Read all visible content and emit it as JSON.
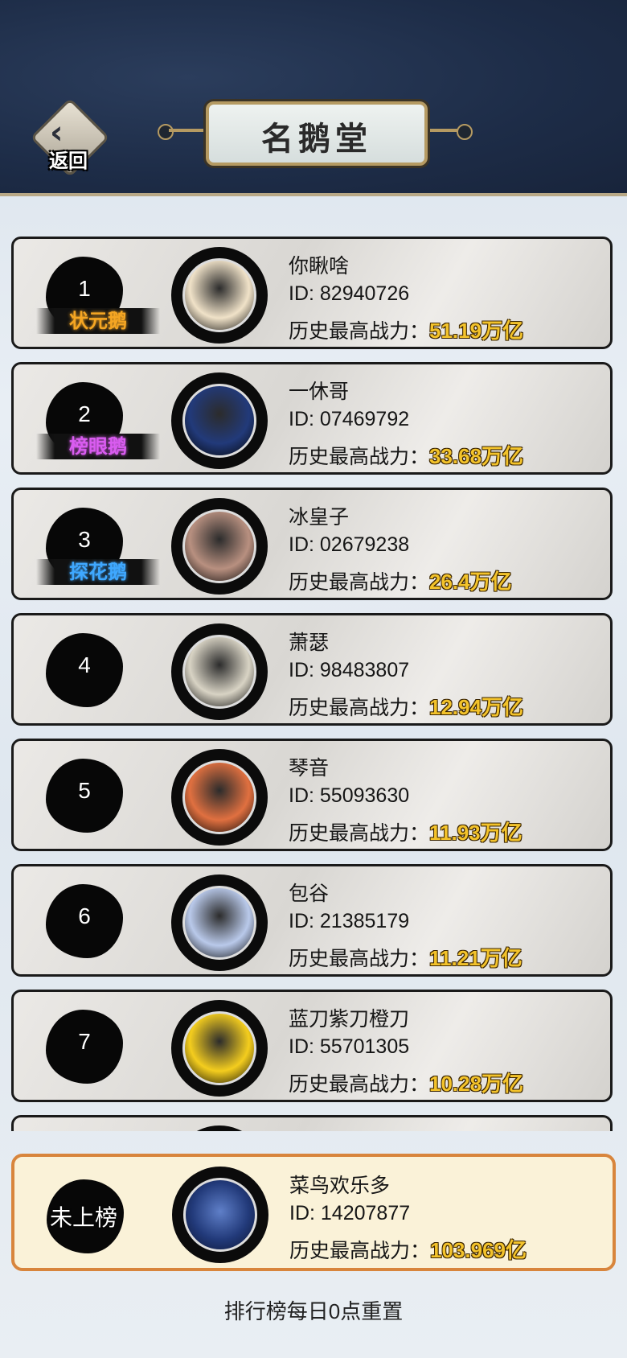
{
  "header": {
    "title": "名鹅堂",
    "back_label": "返回"
  },
  "ranks": [
    {
      "rank": "1",
      "tag": "状元鹅",
      "tag_color": "#f5a623",
      "name": "你瞅啥",
      "id": "ID: 82940726",
      "power_label": "历史最高战力：",
      "power": "51.19万亿",
      "avatar": "ironman-avatar",
      "avatar_bg": "#f0e2c8"
    },
    {
      "rank": "2",
      "tag": "榜眼鹅",
      "tag_color": "#d95cf0",
      "name": "一休哥",
      "id": "ID: 07469792",
      "power_label": "历史最高战力：",
      "power": "33.68万亿",
      "avatar": "ninja-avatar",
      "avatar_bg": "#223a7a"
    },
    {
      "rank": "3",
      "tag": "探花鹅",
      "tag_color": "#3fa8ff",
      "name": "冰皇子",
      "id": "ID: 02679238",
      "power_label": "历史最高战力：",
      "power": "26.4万亿",
      "avatar": "kids-photo-avatar",
      "avatar_bg": "#b89080"
    },
    {
      "rank": "4",
      "tag": "",
      "tag_color": "",
      "name": "萧瑟",
      "id": "ID: 98483807",
      "power_label": "历史最高战力：",
      "power": "12.94万亿",
      "avatar": "cartoon-cat-avatar",
      "avatar_bg": "#d8d3c4"
    },
    {
      "rank": "5",
      "tag": "",
      "tag_color": "",
      "name": "琴音",
      "id": "ID: 55093630",
      "power_label": "历史最高战力：",
      "power": "11.93万亿",
      "avatar": "fortune-cat-avatar",
      "avatar_bg": "#e07040"
    },
    {
      "rank": "6",
      "tag": "",
      "tag_color": "",
      "name": "包谷",
      "id": "ID: 21385179",
      "power_label": "历史最高战力：",
      "power": "11.21万亿",
      "avatar": "anime-girl-avatar",
      "avatar_bg": "#b9c9ea"
    },
    {
      "rank": "7",
      "tag": "",
      "tag_color": "",
      "name": "蓝刀紫刀橙刀",
      "id": "ID: 55701305",
      "power_label": "历史最高战力：",
      "power": "10.28万亿",
      "avatar": "goose-avatar",
      "avatar_bg": "#f4cd1e"
    }
  ],
  "self": {
    "rank": "未上榜",
    "name": "菜鸟欢乐多",
    "id": "ID: 14207877",
    "power_label": "历史最高战力：",
    "power": "103.969亿",
    "avatar": "ninja-avatar",
    "avatar_bg": "#223a7a"
  },
  "footer": {
    "note": "排行榜每日0点重置"
  }
}
